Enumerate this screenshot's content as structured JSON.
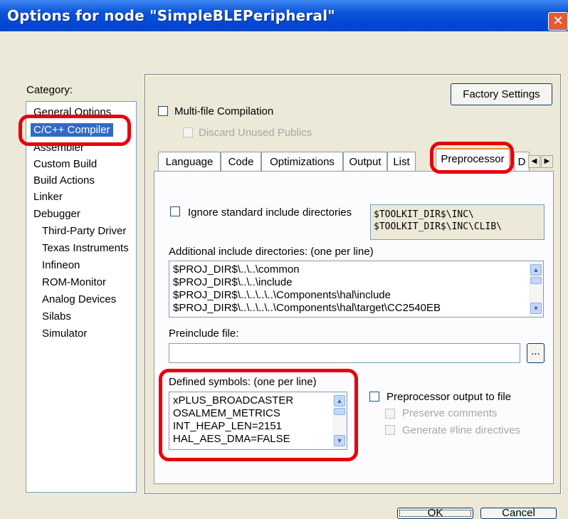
{
  "window": {
    "title": "Options for node \"SimpleBLEPeripheral\"",
    "close_glyph": "✕"
  },
  "category": {
    "label": "Category:",
    "items": [
      {
        "label": "General Options"
      },
      {
        "label": "C/C++ Compiler",
        "selected": true
      },
      {
        "label": "Assembler"
      },
      {
        "label": "Custom Build"
      },
      {
        "label": "Build Actions"
      },
      {
        "label": "Linker"
      },
      {
        "label": "Debugger"
      },
      {
        "label": "Third-Party Driver"
      },
      {
        "label": "Texas Instruments"
      },
      {
        "label": "Infineon"
      },
      {
        "label": "ROM-Monitor"
      },
      {
        "label": "Analog Devices"
      },
      {
        "label": "Silabs"
      },
      {
        "label": "Simulator"
      }
    ]
  },
  "factory_settings_label": "Factory Settings",
  "multifile": {
    "label": "Multi-file Compilation",
    "discard_label": "Discard Unused Publics"
  },
  "tabs": [
    "Language",
    "Code",
    "Optimizations",
    "Output",
    "List",
    "Preprocessor",
    "D"
  ],
  "active_tab": "Preprocessor",
  "preprocessor": {
    "ignore_std_label": "Ignore standard include directories",
    "std_dirs": [
      "$TOOLKIT_DIR$\\INC\\",
      "$TOOLKIT_DIR$\\INC\\CLIB\\"
    ],
    "additional_label": "Additional include directories: (one per line)",
    "additional_dirs": [
      "$PROJ_DIR$\\..\\..\\common",
      "$PROJ_DIR$\\..\\..\\include",
      "$PROJ_DIR$\\..\\..\\..\\..\\Components\\hal\\include",
      "$PROJ_DIR$\\..\\..\\..\\..\\Components\\hal\\target\\CC2540EB"
    ],
    "preinclude_label": "Preinclude file:",
    "preinclude_value": "",
    "browse_label": "...",
    "defined_label": "Defined symbols: (one per line)",
    "defined_symbols": [
      "xPLUS_BROADCASTER",
      "OSALMEM_METRICS",
      "INT_HEAP_LEN=2151",
      "HAL_AES_DMA=FALSE"
    ],
    "pp_output_label": "Preprocessor output to file",
    "preserve_comments_label": "Preserve comments",
    "generate_line_label": "Generate #line directives"
  },
  "buttons": {
    "ok": "OK",
    "cancel": "Cancel"
  },
  "colors": {
    "title_bar": "#0b55d8",
    "selection": "#316ac5",
    "highlight_oval": "#e8000c",
    "active_tab_accent": "#e68b2c"
  }
}
